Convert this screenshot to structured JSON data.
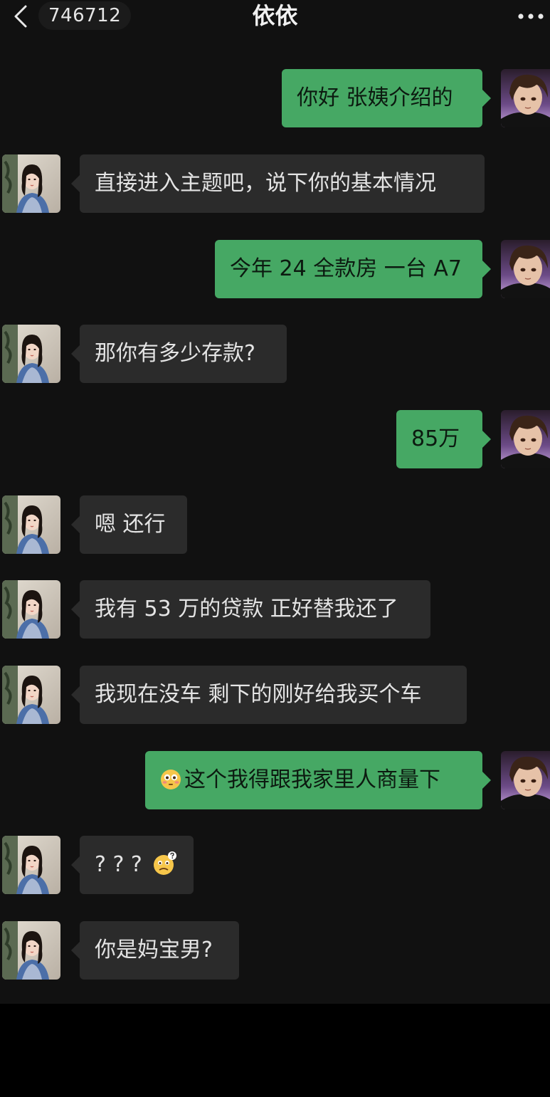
{
  "header": {
    "unread_count": "746712",
    "contact_name": "依依"
  },
  "messages": [
    {
      "side": "out",
      "text": "你好 张姨介绍的"
    },
    {
      "side": "in",
      "text": "直接进入主题吧，说下你的基本情况"
    },
    {
      "side": "out",
      "text": "今年 24 全款房 一台 A7"
    },
    {
      "side": "in",
      "text": "那你有多少存款?"
    },
    {
      "side": "out",
      "text": "85万"
    },
    {
      "side": "in",
      "text": "嗯 还行"
    },
    {
      "side": "in",
      "text": "我有 53 万的贷款 正好替我还了"
    },
    {
      "side": "in",
      "text": "我现在没车 剩下的刚好给我买个车"
    },
    {
      "side": "out",
      "text": "这个我得跟我家里人商量下",
      "emoji_before": "flushed-face-emoji"
    },
    {
      "side": "in",
      "text": "? ? ?",
      "emoji_after": "confused-face-emoji"
    },
    {
      "side": "in",
      "text": "你是妈宝男?"
    }
  ],
  "colors": {
    "background": "#111111",
    "incoming_bubble": "#2b2b2b",
    "outgoing_bubble": "#46a864"
  }
}
